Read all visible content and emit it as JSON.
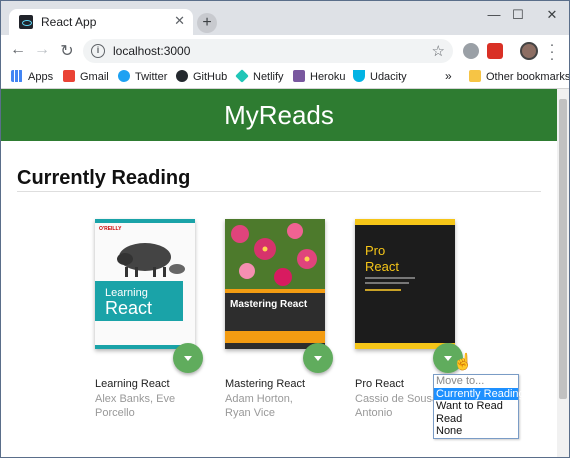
{
  "browser": {
    "tab_title": "React App",
    "new_tab_symbol": "+",
    "close_symbol": "✕",
    "url": "localhost:3000",
    "window_controls": {
      "minimize": "—",
      "maximize": "☐",
      "close": "✕"
    },
    "nav": {
      "back": "←",
      "forward": "→",
      "reload": "↻"
    },
    "bookmarks": [
      {
        "label": "Apps",
        "icon": "apps-icon",
        "color": "#4285f4"
      },
      {
        "label": "Gmail",
        "icon": "gmail-icon",
        "color": "#ea4335"
      },
      {
        "label": "Twitter",
        "icon": "twitter-icon",
        "color": "#1da1f2"
      },
      {
        "label": "GitHub",
        "icon": "github-icon",
        "color": "#24292e"
      },
      {
        "label": "Netlify",
        "icon": "netlify-icon",
        "color": "#20c6b7"
      },
      {
        "label": "Heroku",
        "icon": "heroku-icon",
        "color": "#79589f"
      },
      {
        "label": "Udacity",
        "icon": "udacity-icon",
        "color": "#02b3e4"
      }
    ],
    "more_bookmarks": "»",
    "other_bookmarks": "Other bookmarks"
  },
  "app": {
    "title": "MyReads",
    "header_color": "#2e7c31",
    "shelf_title": "Currently Reading",
    "books": [
      {
        "title": "Learning React",
        "authors": "Alex Banks, Eve Porcello"
      },
      {
        "title": "Mastering React",
        "authors": "Adam Horton, Ryan Vice"
      },
      {
        "title": "Pro React",
        "authors": "Cassio de Sousa Antonio"
      }
    ],
    "move_menu": {
      "options": [
        "Move to...",
        "Currently Reading",
        "Want to Read",
        "Read",
        "None"
      ],
      "selected": "Currently Reading"
    }
  }
}
